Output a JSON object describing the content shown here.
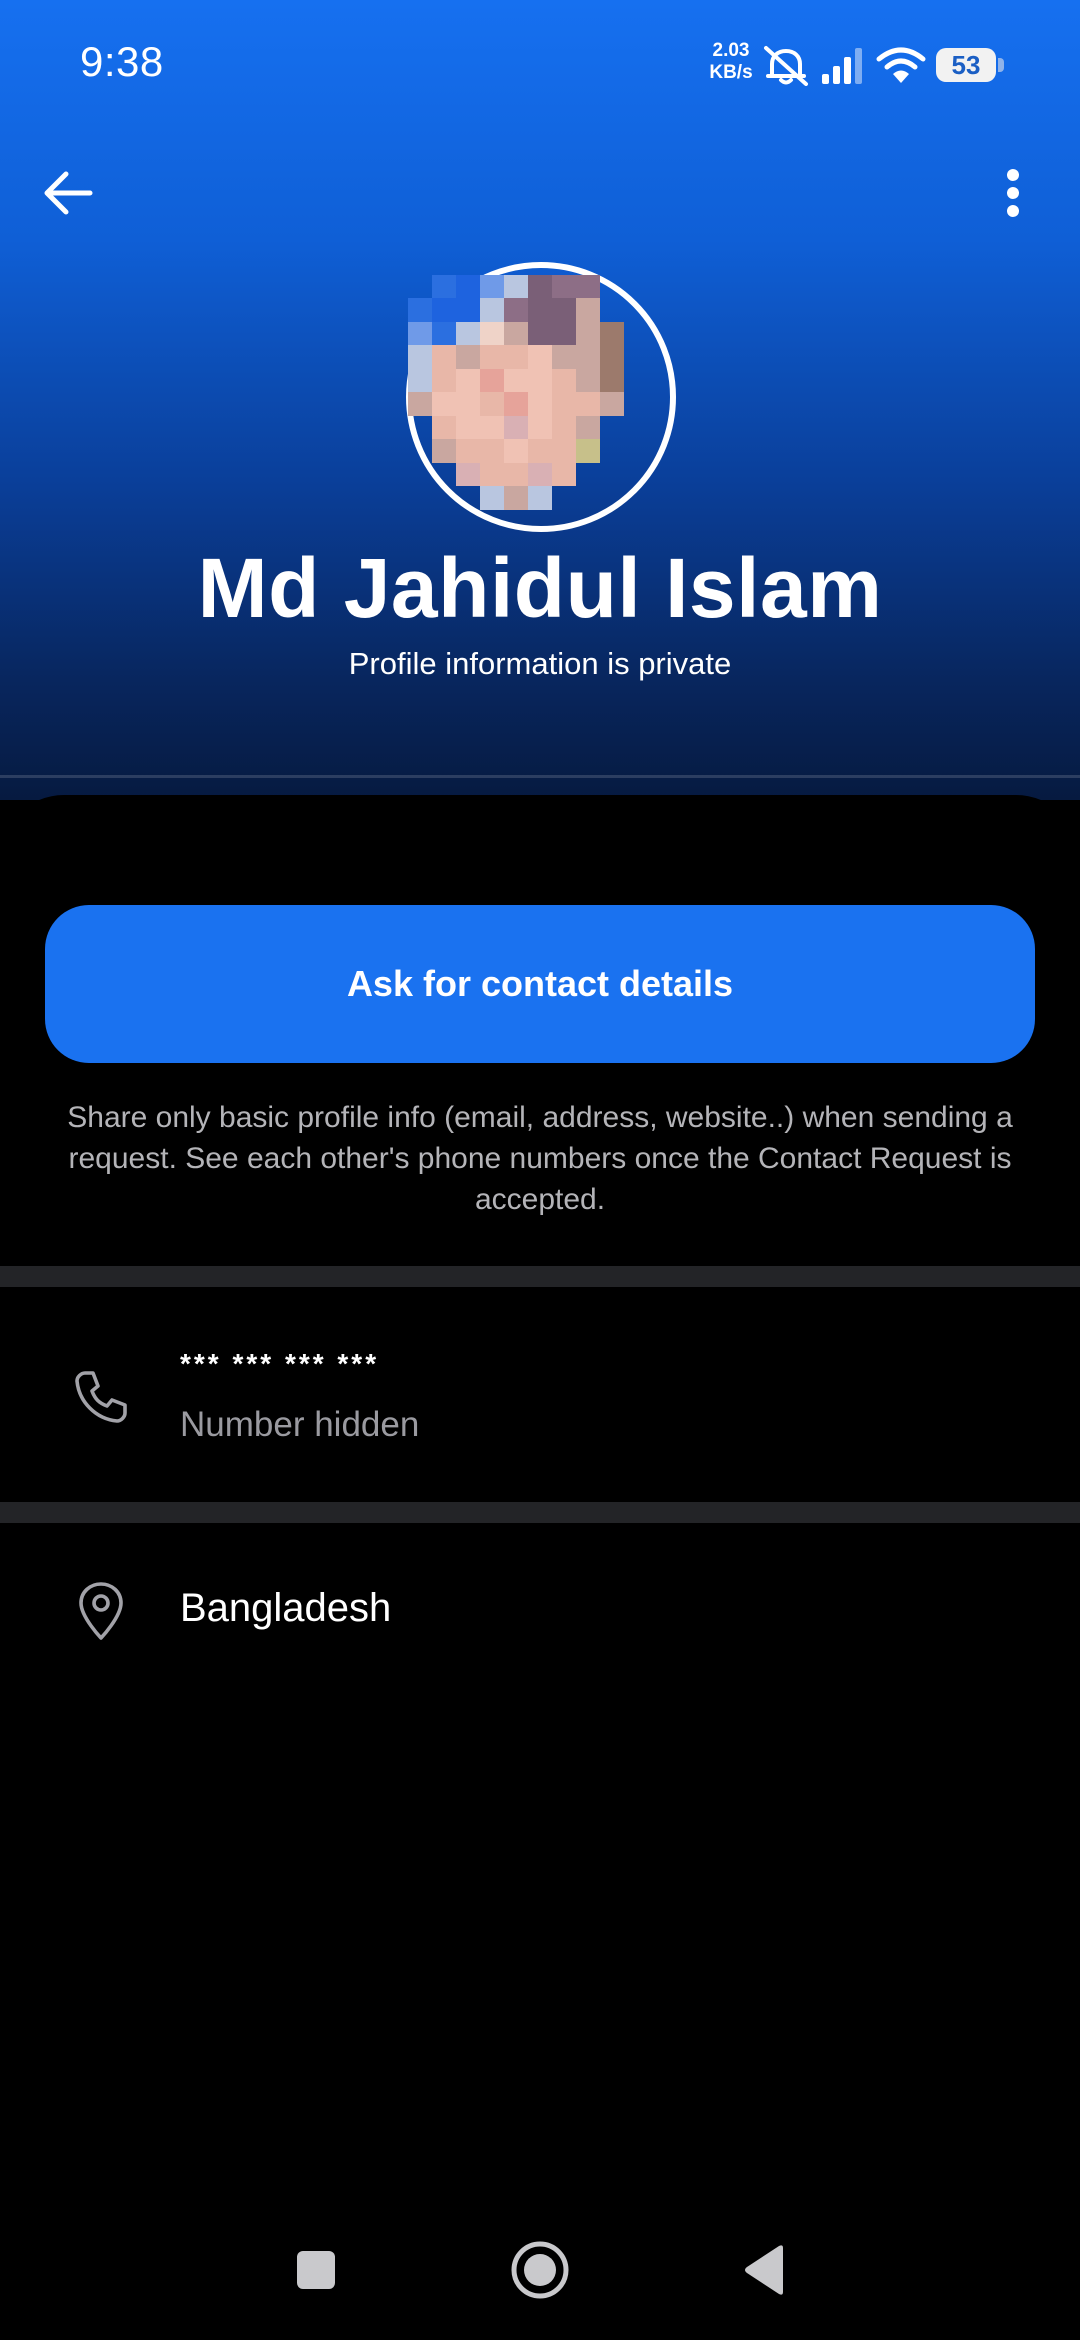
{
  "status_bar": {
    "time": "9:38",
    "net_speed_value": "2.03",
    "net_speed_unit": "KB/s",
    "battery": "53",
    "icons": [
      "mute-bell-icon",
      "signal-icon",
      "wifi-icon",
      "battery-icon"
    ]
  },
  "toolbar": {
    "back_icon": "back-arrow-icon",
    "more_icon": "more-vert-icon"
  },
  "profile": {
    "name": "Md Jahidul Islam",
    "subtitle": "Profile information is private",
    "avatar": "pixelated-avatar"
  },
  "actions": {
    "ask_button": "Ask for contact details",
    "note": "Share only basic profile info (email, address, website..) when sending a request. See each other's phone numbers once the Contact Request is accepted."
  },
  "phone": {
    "masked": "*** *** *** ***",
    "label": "Number hidden",
    "icon": "phone-icon"
  },
  "location": {
    "country": "Bangladesh",
    "icon": "location-pin-icon"
  },
  "nav": {
    "icons": [
      "recents-square-icon",
      "home-circle-icon",
      "back-triangle-icon"
    ]
  },
  "colors": {
    "accent": "#1a72f0",
    "background": "#000000",
    "separator": "#232427",
    "muted_text": "#9a9aa0"
  }
}
